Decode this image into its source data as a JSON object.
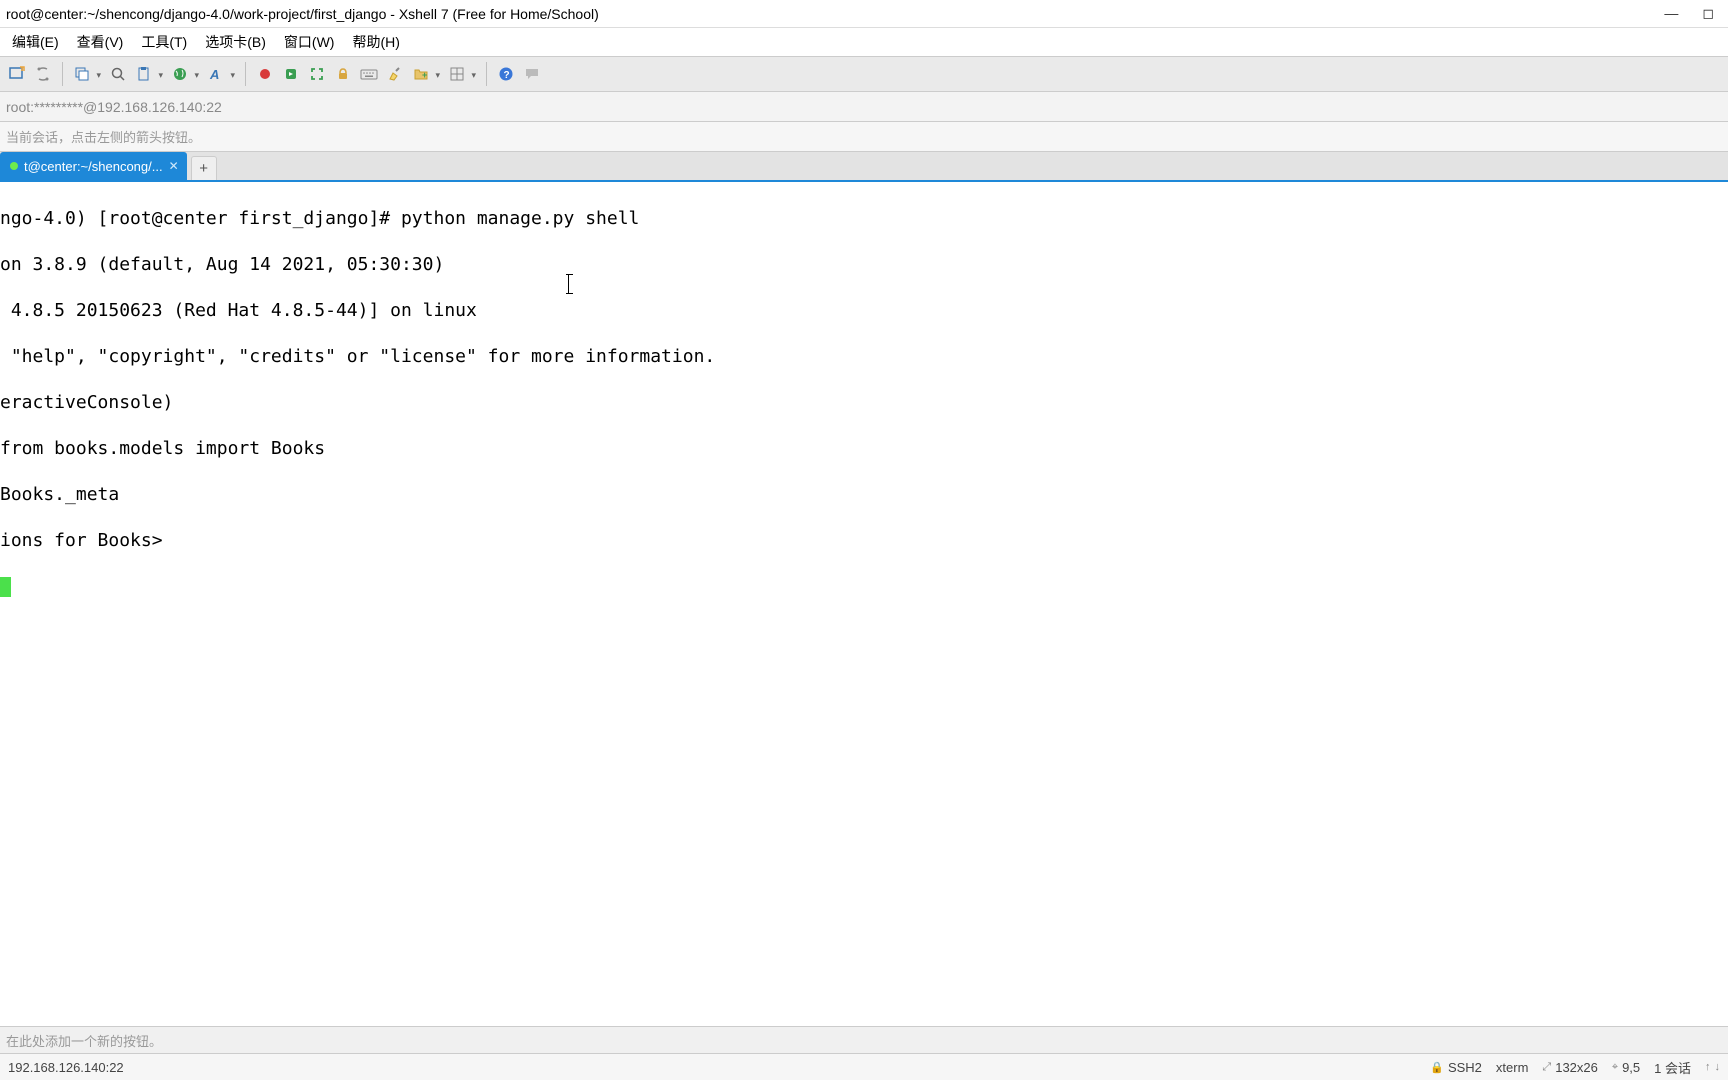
{
  "window": {
    "title": " root@center:~/shencong/django-4.0/work-project/first_django - Xshell 7 (Free for Home/School)"
  },
  "menu": {
    "edit": "编辑(E)",
    "view": "查看(V)",
    "tools": "工具(T)",
    "tabs": "选项卡(B)",
    "window": "窗口(W)",
    "help": "帮助(H)"
  },
  "addressbar": {
    "text": "root:*********@192.168.126.140:22"
  },
  "hint_top": "当前会话，点击左侧的箭头按钮。",
  "tab": {
    "label": "t@center:~/shencong/..."
  },
  "terminal_lines": [
    "ngo-4.0) [root@center first_django]# python manage.py shell",
    "on 3.8.9 (default, Aug 14 2021, 05:30:30)",
    " 4.8.5 20150623 (Red Hat 4.8.5-44)] on linux",
    " \"help\", \"copyright\", \"credits\" or \"license\" for more information.",
    "eractiveConsole)",
    "from books.models import Books",
    "Books._meta",
    "ions for Books>"
  ],
  "hint_bottom": "在此处添加一个新的按钮。",
  "status": {
    "left": "192.168.126.140:22",
    "ssh": "SSH2",
    "term": "xterm",
    "size": "132x26",
    "cursor": "9,5",
    "session": "1 会话"
  }
}
